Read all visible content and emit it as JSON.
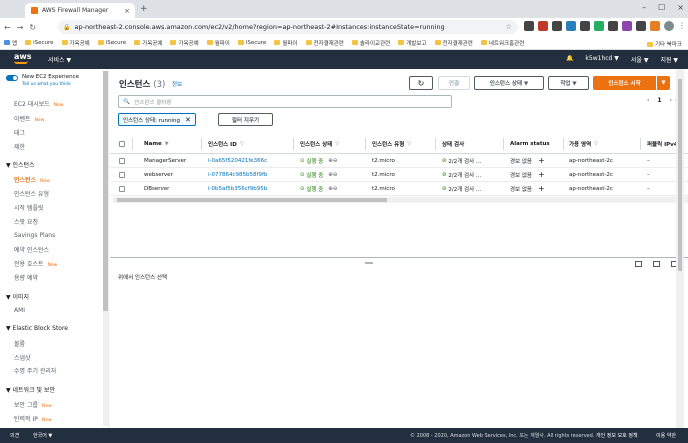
{
  "browser": {
    "tab_title": "AWS Firewall Manager",
    "url": "ap-northeast-2.console.aws.amazon.com/ec2/v2/home?region=ap-northeast-2#Instances:instanceState=running",
    "bookmarks": [
      "앱",
      "iSecure",
      "가옥공예",
      "iSecure",
      "가옥공예",
      "가옥공예",
      "월파이",
      "iSecure",
      "월파이",
      "전자결재관련",
      "솔라이교관련",
      "개발보고",
      "전자결재관련",
      "네트워크홈관련"
    ],
    "bookmarks_more": "기타 북마크"
  },
  "aws_nav": {
    "logo": "aws",
    "services": "서비스 ▼",
    "user": "k5w1hcd ▼",
    "region": "서울 ▼",
    "support": "지원 ▼"
  },
  "sidebar": {
    "new_exp_title": "New EC2 Experience",
    "new_exp_sub": "Tell us what you think",
    "dashboard": "EC2 대시보드",
    "events": "이벤트",
    "tags": "태그",
    "limits": "제한",
    "new_badge": "New",
    "sections": [
      {
        "title": "▼ 인스턴스",
        "items": [
          "인스턴스",
          "인스턴스 유형",
          "시작 템플릿",
          "스팟 요청",
          "Savings Plans",
          "예약 인스턴스",
          "전용 호스트",
          "용량 예약"
        ]
      },
      {
        "title": "▼ 이미지",
        "items": [
          "AMI"
        ]
      },
      {
        "title": "▼ Elastic Block Store",
        "items": [
          "볼륨",
          "스냅샷",
          "수명 주기 관리자"
        ]
      },
      {
        "title": "▼ 네트워크 및 보안",
        "items": [
          "보안 그룹",
          "탄력적 IP"
        ]
      }
    ]
  },
  "main": {
    "title": "인스턴스",
    "count": "(3)",
    "info": "정보",
    "connect": "연결",
    "instance_state": "인스턴스 상태 ▼",
    "actions": "작업 ▼",
    "launch": "인스턴스 시작",
    "search_placeholder": "인스턴스 필터링",
    "page": "1",
    "filter_chip": "인스턴스 상태: running",
    "clear_filters": "필터 지우기",
    "columns": [
      "Name",
      "인스턴스 ID",
      "인스턴스 상태",
      "인스턴스 유형",
      "상태 검사",
      "Alarm status",
      "가용 영역",
      "퍼블릭 IPv4"
    ],
    "rows": [
      {
        "name": "ManagerServer",
        "id": "i-0a65f520421fe366c",
        "state": "실행 중",
        "type": "t2.micro",
        "check": "2/2개 검사 ...",
        "alarm": "경보 없음",
        "az": "ap-northeast-2c",
        "ip": "–"
      },
      {
        "name": "webserver",
        "id": "i-077864c985b58f9fb",
        "state": "실행 중",
        "type": "t2.micro",
        "check": "2/2개 검사 ...",
        "alarm": "경보 없음",
        "az": "ap-northeast-2c",
        "ip": "–"
      },
      {
        "name": "DBserver",
        "id": "i-0b5af5b356cf9b95b",
        "state": "실행 중",
        "type": "t2.micro",
        "check": "2/2개 검사 ...",
        "alarm": "경보 없음",
        "az": "ap-northeast-2c",
        "ip": "–"
      }
    ],
    "select_message": "위에서 인스턴스 선택"
  },
  "footer": {
    "feedback": "의견",
    "language": "한국어 ▼",
    "copyright": "© 2008 - 2020, Amazon Web Services, Inc. 또는 계열사. All rights reserved.",
    "privacy": "개인 정보 보호 정책",
    "terms": "이용 약관"
  },
  "colors": {
    "aws_nav": "#232f3e",
    "accent": "#ec7211",
    "link": "#0073bb",
    "ok": "#1d8102"
  }
}
